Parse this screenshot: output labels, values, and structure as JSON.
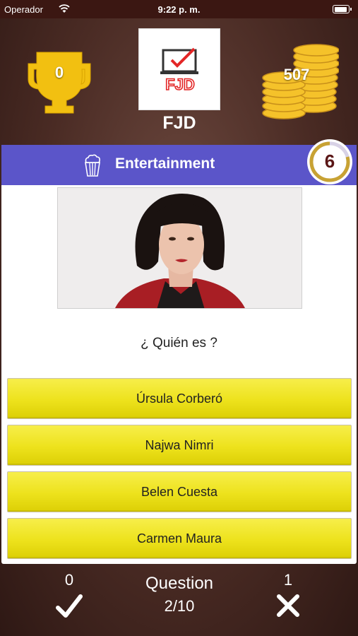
{
  "status_bar": {
    "carrier": "Operador",
    "time": "9:22 p. m."
  },
  "header": {
    "trophy_count": "0",
    "user_logo_text": "FJD",
    "user_name": "FJD",
    "coins": "507"
  },
  "category": {
    "icon": "popcorn-icon",
    "label": "Entertainment",
    "timer": "6"
  },
  "question": {
    "image": "portrait-photo",
    "text": "¿ Quién es ?"
  },
  "answers": [
    {
      "label": "Úrsula Corberó"
    },
    {
      "label": "Najwa Nimri"
    },
    {
      "label": "Belen Cuesta"
    },
    {
      "label": "Carmen Maura"
    }
  ],
  "footer": {
    "correct_count": "0",
    "question_label": "Question",
    "question_progress": "2/10",
    "wrong_count": "1"
  },
  "colors": {
    "category_bar": "#5b55c9",
    "answer_button": "#ede21c",
    "timer_ring": "#c8a233",
    "background": "#4a2b24"
  }
}
